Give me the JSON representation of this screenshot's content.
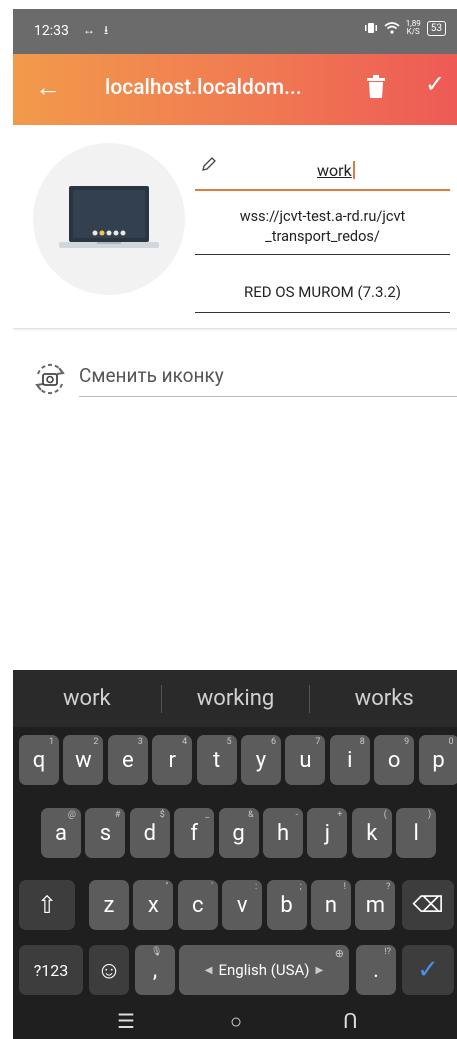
{
  "status_bar": {
    "time": "12:33",
    "left_icons": "↔ ⭳",
    "net_speed_top": "1,89",
    "net_speed_bottom": "K/S",
    "battery": "53"
  },
  "app_bar": {
    "title": "localhost.localdom...",
    "back_icon": "←",
    "confirm_icon": "✓"
  },
  "host": {
    "name_value": "work",
    "url": "wss://jcvt-test.a-rd.ru/jcvt_transport_redos/",
    "url_line1": "wss://jcvt-test.a-rd.ru/jcvt",
    "url_line2": "_transport_redos/",
    "os": "RED OS MUROM (7.3.2)"
  },
  "change_icon": {
    "label": "Сменить иконку"
  },
  "keyboard": {
    "suggestions": [
      "work",
      "working",
      "works"
    ],
    "row1": [
      {
        "k": "q",
        "h": "1"
      },
      {
        "k": "w",
        "h": "2"
      },
      {
        "k": "e",
        "h": "3"
      },
      {
        "k": "r",
        "h": "4"
      },
      {
        "k": "t",
        "h": "5"
      },
      {
        "k": "y",
        "h": "6"
      },
      {
        "k": "u",
        "h": "7"
      },
      {
        "k": "i",
        "h": "8"
      },
      {
        "k": "o",
        "h": "9"
      },
      {
        "k": "p",
        "h": "0"
      }
    ],
    "row2": [
      {
        "k": "a",
        "h": "@"
      },
      {
        "k": "s",
        "h": "#"
      },
      {
        "k": "d",
        "h": "$"
      },
      {
        "k": "f",
        "h": "_"
      },
      {
        "k": "g",
        "h": "&"
      },
      {
        "k": "h",
        "h": "-"
      },
      {
        "k": "j",
        "h": "+"
      },
      {
        "k": "k",
        "h": "("
      },
      {
        "k": "l",
        "h": ")"
      }
    ],
    "row3": [
      {
        "k": "z",
        "h": ""
      },
      {
        "k": "x",
        "h": "\""
      },
      {
        "k": "c",
        "h": "'"
      },
      {
        "k": "v",
        "h": ":"
      },
      {
        "k": "b",
        "h": ";"
      },
      {
        "k": "n",
        "h": "!"
      },
      {
        "k": "m",
        "h": "?"
      }
    ],
    "symbols_label": "?123",
    "space_label": "English (USA)",
    "comma": ",",
    "period": ".",
    "period_hint": "!?",
    "shift_icon": "⇧",
    "backspace_icon": "⌫",
    "emoji_icon": "☺",
    "enter_icon": "✓",
    "nav_recent": "☰",
    "nav_home": "○",
    "nav_back": "ᑎ"
  }
}
